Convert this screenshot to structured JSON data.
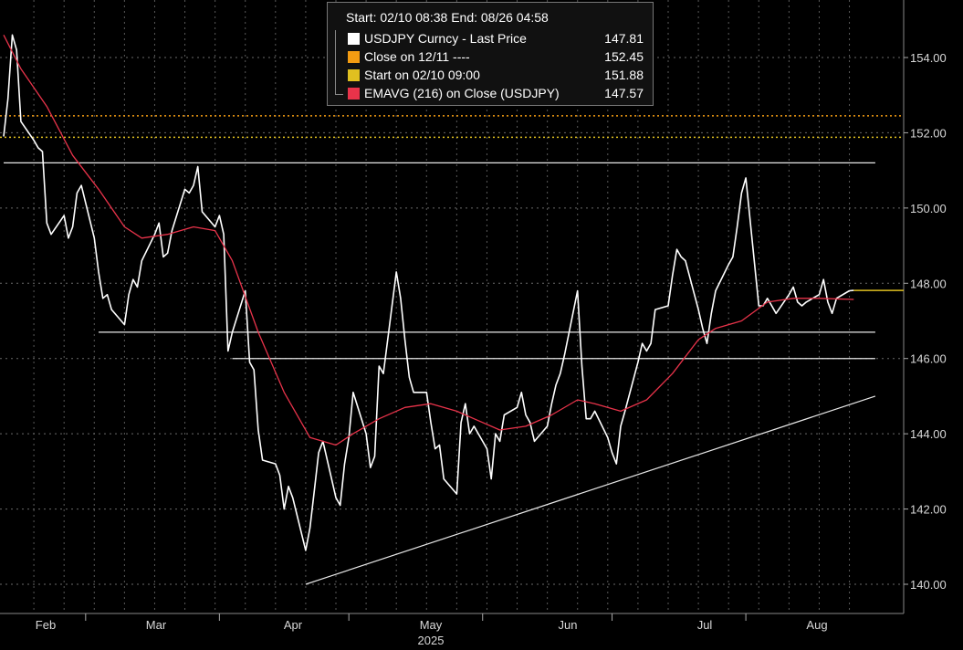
{
  "legend": {
    "header": "Start: 02/10 08:38 End: 08/26 04:58",
    "items": [
      {
        "label": "USDJPY Curncy - Last Price",
        "value": "147.81",
        "color": "#ffffff"
      },
      {
        "label": "Close on 12/11 ----",
        "value": "152.45",
        "color": "#f39c12"
      },
      {
        "label": "Start on 02/10 09:00",
        "value": "151.88",
        "color": "#e0c020"
      },
      {
        "label": "EMAVG (216)  on Close (USDJPY)",
        "value": "147.57",
        "color": "#e8334a"
      }
    ]
  },
  "chart_data": {
    "type": "line",
    "title": "",
    "xlabel": "",
    "ylabel": "",
    "x_ticks": [
      "Feb",
      "Mar",
      "Apr",
      "May",
      "Jun",
      "Jul",
      "Aug"
    ],
    "year_label": "2025",
    "y_ticks": [
      "140.00",
      "142.00",
      "144.00",
      "146.00",
      "148.00",
      "150.00",
      "152.00",
      "154.00"
    ],
    "ylim": [
      139.5,
      155.5
    ],
    "xlim": [
      "2025-02-10",
      "2025-08-31"
    ],
    "grid": true,
    "series": [
      {
        "name": "USDJPY Curncy - Last Price",
        "color": "#ffffff",
        "x": [
          "2025-02-10",
          "2025-02-11",
          "2025-02-12",
          "2025-02-13",
          "2025-02-14",
          "2025-02-17",
          "2025-02-18",
          "2025-02-19",
          "2025-02-20",
          "2025-02-21",
          "2025-02-24",
          "2025-02-25",
          "2025-02-26",
          "2025-02-27",
          "2025-02-28",
          "2025-03-03",
          "2025-03-04",
          "2025-03-05",
          "2025-03-06",
          "2025-03-07",
          "2025-03-10",
          "2025-03-11",
          "2025-03-12",
          "2025-03-13",
          "2025-03-14",
          "2025-03-17",
          "2025-03-18",
          "2025-03-19",
          "2025-03-20",
          "2025-03-21",
          "2025-03-24",
          "2025-03-25",
          "2025-03-26",
          "2025-03-27",
          "2025-03-28",
          "2025-03-31",
          "2025-04-01",
          "2025-04-02",
          "2025-04-03",
          "2025-04-04",
          "2025-04-07",
          "2025-04-08",
          "2025-04-09",
          "2025-04-10",
          "2025-04-11",
          "2025-04-14",
          "2025-04-15",
          "2025-04-16",
          "2025-04-17",
          "2025-04-18",
          "2025-04-21",
          "2025-04-22",
          "2025-04-23",
          "2025-04-24",
          "2025-04-25",
          "2025-04-28",
          "2025-04-29",
          "2025-04-30",
          "2025-05-01",
          "2025-05-02",
          "2025-05-05",
          "2025-05-06",
          "2025-05-07",
          "2025-05-08",
          "2025-05-09",
          "2025-05-12",
          "2025-05-13",
          "2025-05-14",
          "2025-05-15",
          "2025-05-16",
          "2025-05-19",
          "2025-05-20",
          "2025-05-21",
          "2025-05-22",
          "2025-05-23",
          "2025-05-26",
          "2025-05-27",
          "2025-05-28",
          "2025-05-29",
          "2025-05-30",
          "2025-06-02",
          "2025-06-03",
          "2025-06-04",
          "2025-06-05",
          "2025-06-06",
          "2025-06-09",
          "2025-06-10",
          "2025-06-11",
          "2025-06-12",
          "2025-06-13",
          "2025-06-16",
          "2025-06-17",
          "2025-06-18",
          "2025-06-19",
          "2025-06-20",
          "2025-06-23",
          "2025-06-24",
          "2025-06-25",
          "2025-06-26",
          "2025-06-27",
          "2025-06-30",
          "2025-07-01",
          "2025-07-02",
          "2025-07-03",
          "2025-07-04",
          "2025-07-07",
          "2025-07-08",
          "2025-07-09",
          "2025-07-10",
          "2025-07-11",
          "2025-07-14",
          "2025-07-15",
          "2025-07-16",
          "2025-07-17",
          "2025-07-18",
          "2025-07-21",
          "2025-07-22",
          "2025-07-23",
          "2025-07-24",
          "2025-07-25",
          "2025-07-28",
          "2025-07-29",
          "2025-07-30",
          "2025-07-31",
          "2025-08-01",
          "2025-08-04",
          "2025-08-05",
          "2025-08-06",
          "2025-08-07",
          "2025-08-08",
          "2025-08-11",
          "2025-08-12",
          "2025-08-13",
          "2025-08-14",
          "2025-08-15",
          "2025-08-18",
          "2025-08-19",
          "2025-08-20",
          "2025-08-21",
          "2025-08-22",
          "2025-08-25",
          "2025-08-26"
        ],
        "y": [
          151.9,
          152.9,
          154.6,
          154.2,
          152.3,
          151.8,
          151.6,
          151.5,
          149.6,
          149.3,
          149.8,
          149.2,
          149.5,
          150.4,
          150.6,
          149.2,
          148.3,
          147.6,
          147.7,
          147.3,
          146.9,
          147.7,
          148.1,
          147.9,
          148.6,
          149.3,
          149.6,
          148.7,
          148.8,
          149.4,
          150.5,
          150.4,
          150.6,
          151.1,
          149.9,
          149.5,
          149.8,
          149.3,
          146.2,
          146.7,
          147.8,
          145.9,
          145.7,
          144.1,
          143.3,
          143.2,
          142.9,
          142.0,
          142.6,
          142.3,
          140.9,
          141.5,
          142.5,
          143.5,
          143.8,
          142.3,
          142.1,
          143.2,
          143.9,
          145.1,
          144.0,
          143.1,
          143.4,
          145.8,
          145.6,
          148.3,
          147.6,
          146.5,
          145.5,
          145.1,
          145.1,
          144.3,
          143.6,
          143.7,
          142.8,
          142.4,
          144.3,
          144.8,
          144.0,
          144.2,
          143.6,
          142.8,
          144.0,
          143.8,
          144.5,
          144.7,
          145.1,
          144.5,
          144.3,
          143.8,
          144.2,
          144.8,
          145.3,
          145.6,
          146.1,
          147.8,
          145.8,
          144.4,
          144.4,
          144.6,
          143.9,
          143.5,
          143.2,
          144.2,
          144.6,
          145.9,
          146.4,
          146.2,
          146.4,
          147.3,
          147.4,
          148.2,
          148.9,
          148.7,
          148.6,
          147.3,
          146.8,
          146.4,
          147.2,
          147.8,
          148.5,
          148.7,
          149.5,
          150.4,
          150.8,
          147.4,
          147.4,
          147.6,
          147.4,
          147.2,
          147.7,
          147.9,
          147.5,
          147.4,
          147.5,
          147.7,
          148.1,
          147.5,
          147.2,
          147.6,
          147.8,
          147.81
        ]
      },
      {
        "name": "EMAVG (216)  on Close (USDJPY)",
        "color": "#e8334a",
        "x": [
          "2025-02-10",
          "2025-02-14",
          "2025-02-20",
          "2025-02-26",
          "2025-03-04",
          "2025-03-10",
          "2025-03-14",
          "2025-03-20",
          "2025-03-26",
          "2025-03-31",
          "2025-04-04",
          "2025-04-10",
          "2025-04-16",
          "2025-04-22",
          "2025-04-28",
          "2025-05-02",
          "2025-05-08",
          "2025-05-14",
          "2025-05-20",
          "2025-05-26",
          "2025-05-30",
          "2025-06-05",
          "2025-06-11",
          "2025-06-17",
          "2025-06-23",
          "2025-06-27",
          "2025-07-03",
          "2025-07-09",
          "2025-07-15",
          "2025-07-21",
          "2025-07-25",
          "2025-07-31",
          "2025-08-06",
          "2025-08-12",
          "2025-08-18",
          "2025-08-26"
        ],
        "y": [
          154.6,
          153.7,
          152.7,
          151.4,
          150.5,
          149.5,
          149.2,
          149.3,
          149.5,
          149.4,
          148.6,
          146.7,
          145.1,
          143.9,
          143.7,
          144.0,
          144.4,
          144.7,
          144.8,
          144.6,
          144.4,
          144.1,
          144.2,
          144.5,
          144.9,
          144.8,
          144.6,
          144.9,
          145.6,
          146.5,
          146.8,
          147.0,
          147.5,
          147.6,
          147.6,
          147.57
        ]
      }
    ],
    "reference_lines": [
      {
        "name": "Close on 12/11 ----",
        "value": 152.45,
        "color": "#f39c12",
        "style": "dotted"
      },
      {
        "name": "Start on 02/10 09:00",
        "value": 151.88,
        "color": "#e0c020",
        "style": "dotted"
      }
    ],
    "drawn_lines": [
      {
        "x1": "2025-02-10",
        "y1": 151.2,
        "x2": "2025-08-31",
        "y2": 151.2,
        "color": "#e8e8e8"
      },
      {
        "x1": "2025-03-04",
        "y1": 146.7,
        "x2": "2025-08-31",
        "y2": 146.7,
        "color": "#e8e8e8"
      },
      {
        "x1": "2025-04-04",
        "y1": 146.0,
        "x2": "2025-08-31",
        "y2": 146.0,
        "color": "#e8e8e8"
      },
      {
        "x1": "2025-04-21",
        "y1": 140.0,
        "x2": "2025-08-31",
        "y2": 145.0,
        "color": "#e8e8e8"
      }
    ],
    "last_price_marker": {
      "value": 147.81,
      "color": "#e0c020"
    }
  }
}
